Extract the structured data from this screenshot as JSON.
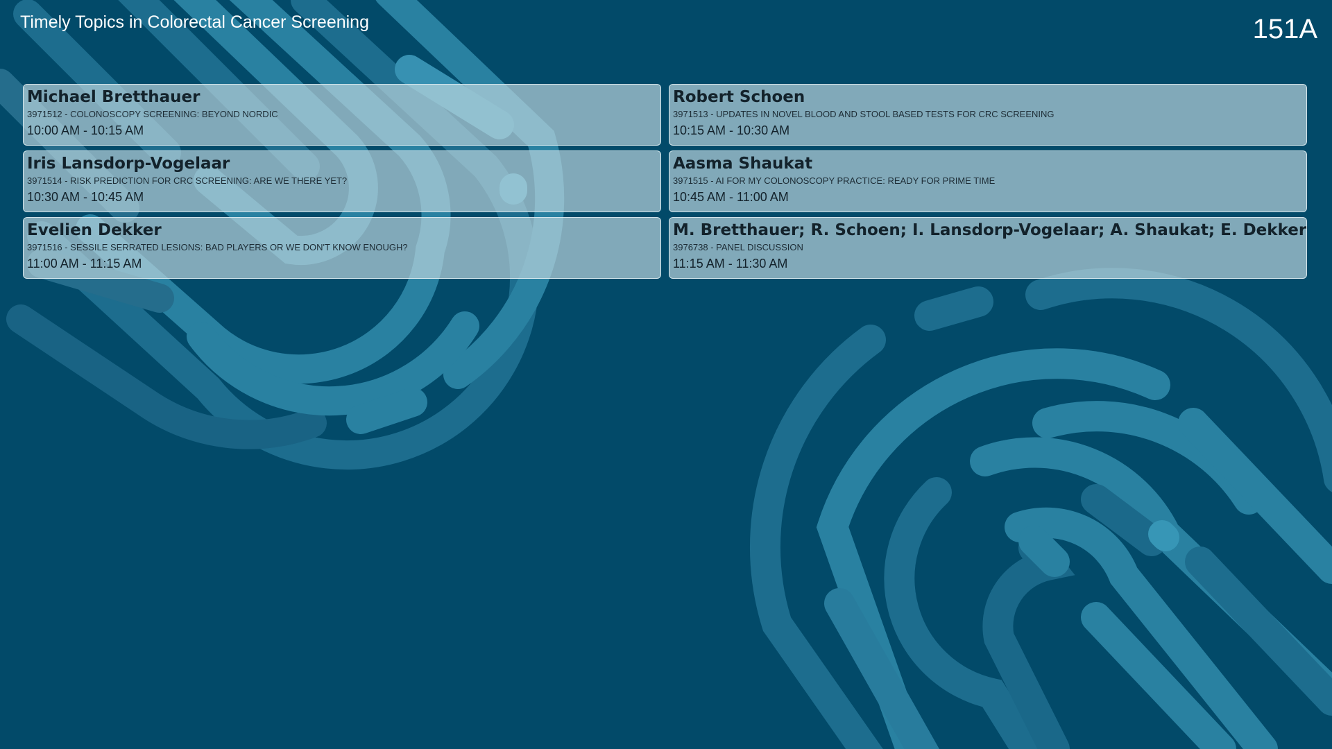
{
  "session": {
    "title": "Timely Topics in Colorectal Cancer Screening",
    "room": "151A"
  },
  "talks": [
    {
      "speaker": "Michael Bretthauer",
      "talk": "3971512 - COLONOSCOPY SCREENING: BEYOND NORDIC",
      "time": "10:00 AM - 10:15 AM"
    },
    {
      "speaker": "Robert Schoen",
      "talk": "3971513 - UPDATES IN NOVEL BLOOD AND STOOL BASED TESTS FOR CRC SCREENING",
      "time": "10:15 AM - 10:30 AM"
    },
    {
      "speaker": "Iris Lansdorp-Vogelaar",
      "talk": "3971514 - RISK PREDICTION FOR CRC SCREENING: ARE WE THERE YET?",
      "time": "10:30 AM - 10:45 AM"
    },
    {
      "speaker": "Aasma Shaukat",
      "talk": "3971515 - AI FOR MY COLONOSCOPY PRACTICE: READY FOR PRIME TIME",
      "time": "10:45 AM - 11:00 AM"
    },
    {
      "speaker": "Evelien Dekker",
      "talk": "3971516 - SESSILE SERRATED LESIONS: BAD PLAYERS OR WE DON'T KNOW ENOUGH?",
      "time": "11:00 AM - 11:15 AM"
    },
    {
      "speaker": "M. Bretthauer; R. Schoen; I. Lansdorp-Vogelaar; A. Shaukat; E. Dekker",
      "talk": "3976738 - PANEL DISCUSSION",
      "time": "11:15 AM - 11:30 AM"
    }
  ],
  "colors": {
    "background": "#024a69",
    "swirl_light": "#2d87a8",
    "swirl_dark": "#1c6b8c",
    "card": "#bed7de"
  },
  "decor": {
    "top_left": "fingerprint-pattern",
    "bottom_right": "fingerprint-pattern"
  }
}
